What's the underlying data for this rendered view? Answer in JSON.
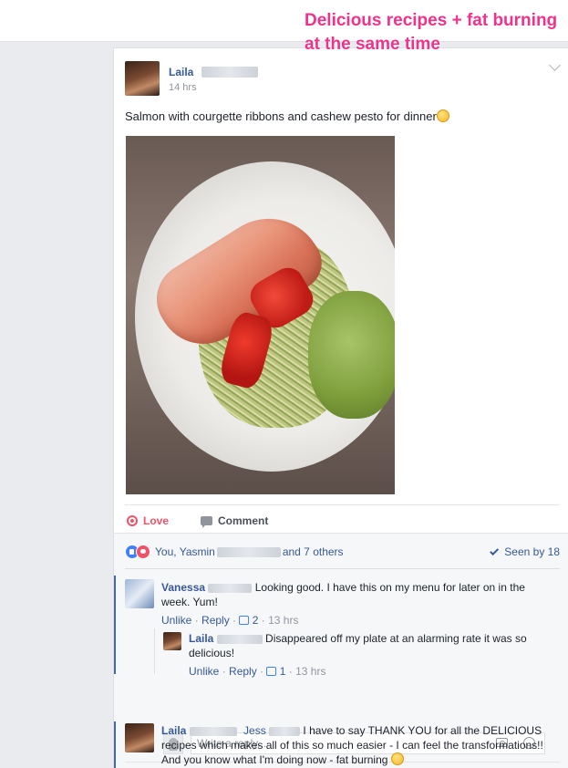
{
  "annotation": "Delicious recipes + fat burning at the same time",
  "post": {
    "author": "Laila",
    "timestamp": "14 hrs",
    "text": "Salmon with courgette ribbons and cashew pesto for dinner",
    "actions": {
      "love": "Love",
      "comment": "Comment"
    }
  },
  "feedback": {
    "reactions_you": "You, Yasmin",
    "reactions_others": "and 7 others",
    "seen": "Seen by 18",
    "comments": [
      {
        "name": "Vanessa",
        "text": "Looking good. I have this on my menu for later on in the week. Yum!",
        "unlike": "Unlike",
        "reply": "Reply",
        "likes": "2",
        "time": "13 hrs"
      },
      {
        "name": "Laila",
        "text": "Disappeared off my plate at an alarming rate it was so delicious!",
        "unlike": "Unlike",
        "reply": "Reply",
        "likes": "1",
        "time": "13 hrs"
      },
      {
        "name": "Laila",
        "mention": "Jess",
        "text": "I have to say THANK YOU for all the DELICIOUS recipes which makes all of this so much easier - I can feel the transformations!! And you know what I'm doing now - fat burning"
      }
    ],
    "reply_placeholder": "Write a reply..."
  },
  "colors": {
    "accent": "#365899",
    "annotation": "#f0328a",
    "love": "#f25268",
    "like": "#4080ff"
  },
  "icons": [
    "chevron-down-icon",
    "emoji-icon",
    "heart-icon",
    "comment-icon",
    "like-reaction-icon",
    "love-reaction-icon",
    "check-icon",
    "thumb-icon",
    "camera-icon",
    "smile-icon"
  ]
}
